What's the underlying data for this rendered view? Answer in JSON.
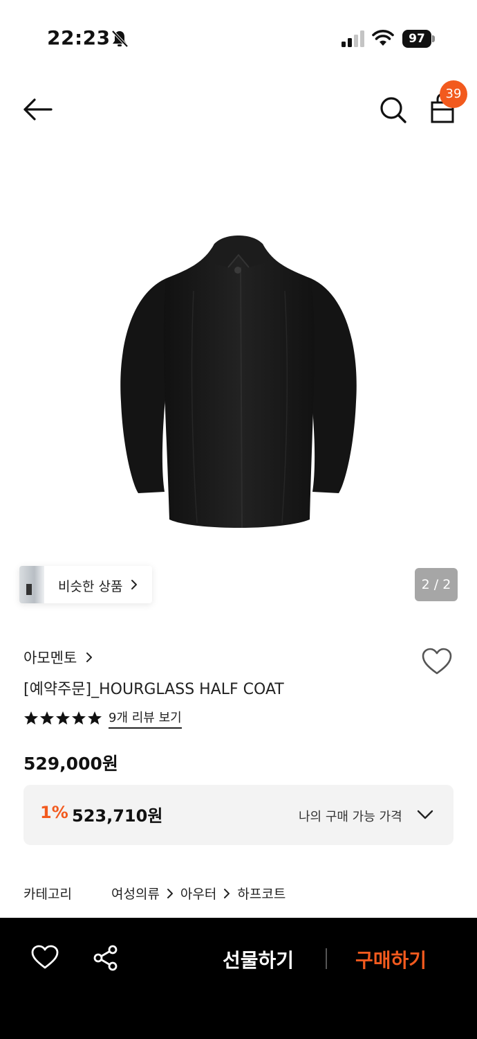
{
  "status_bar": {
    "time": "22:23",
    "battery": "97",
    "icons": [
      "bell-slash-icon",
      "cellular-signal-icon",
      "wifi-icon",
      "battery-icon"
    ]
  },
  "nav": {
    "icons": [
      "arrow-left-icon",
      "search-icon",
      "shopping-bag-icon"
    ],
    "cart_count": "39"
  },
  "gallery": {
    "similar_label": "비슷한 상품",
    "page_indicator": "2 / 2"
  },
  "product": {
    "brand": "아모멘토",
    "title": "[예약주문]_HOURGLASS HALF COAT",
    "rating_stars": 5,
    "review_link": "9개 리뷰 보기",
    "price": "529,000원",
    "discount_rate": "1%",
    "final_price": "523,710원",
    "my_price_label": "나의 구매 가능 가격"
  },
  "category": {
    "label": "카테고리",
    "crumbs": [
      "여성의류",
      "아우터",
      "하프코트"
    ]
  },
  "bottom_bar": {
    "gift_label": "선물하기",
    "buy_label": "구매하기"
  },
  "colors": {
    "accent": "#f25a1e",
    "bottom_bar": "#000000",
    "price_box": "#f3f3f3"
  }
}
